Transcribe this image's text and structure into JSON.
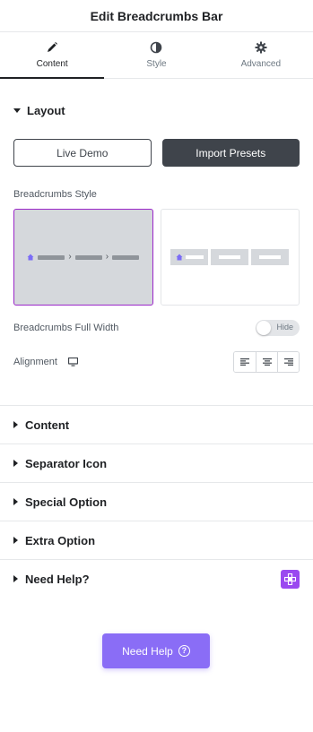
{
  "header": {
    "title": "Edit Breadcrumbs Bar"
  },
  "tabs": [
    {
      "label": "Content",
      "icon": "pencil-icon",
      "active": true
    },
    {
      "label": "Style",
      "icon": "half-circle-icon",
      "active": false
    },
    {
      "label": "Advanced",
      "icon": "gear-icon",
      "active": false
    }
  ],
  "layout": {
    "title": "Layout",
    "live_demo_label": "Live Demo",
    "import_presets_label": "Import Presets",
    "style_label": "Breadcrumbs Style",
    "full_width_label": "Breadcrumbs Full Width",
    "full_width_toggle_text": "Hide",
    "full_width_enabled": false,
    "alignment_label": "Alignment",
    "alignment_options": [
      "left",
      "center",
      "right"
    ]
  },
  "sections": [
    {
      "title": "Content"
    },
    {
      "title": "Separator Icon"
    },
    {
      "title": "Special Option"
    },
    {
      "title": "Extra Option"
    },
    {
      "title": "Need Help?"
    }
  ],
  "need_help_button": {
    "label": "Need Help",
    "icon": "question-circle-icon"
  },
  "colors": {
    "accent_purple": "#9b27c9",
    "need_help_bg": "#8a6df6",
    "dark_button": "#3f444b",
    "breadcrumb_home_icon": "#7b6cf6"
  }
}
